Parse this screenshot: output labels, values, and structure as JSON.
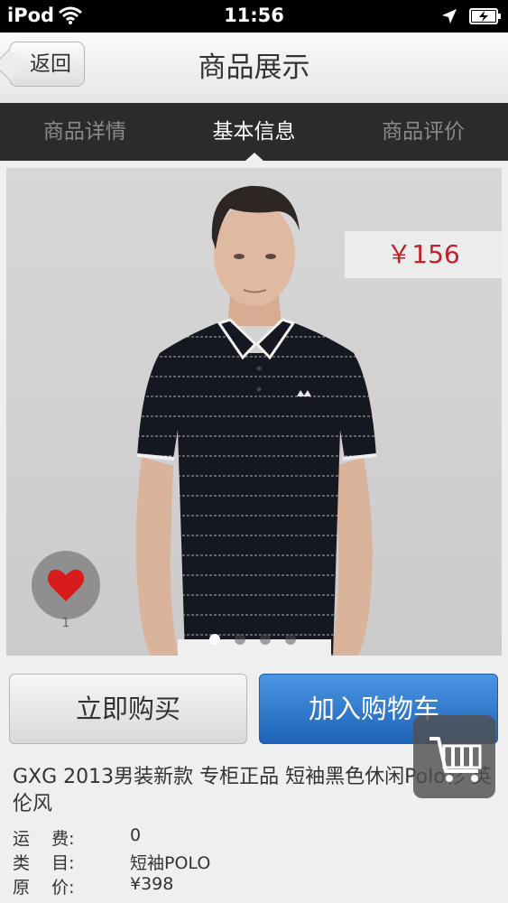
{
  "status_bar": {
    "carrier": "iPod",
    "time": "11:56"
  },
  "navbar": {
    "back_label": "返回",
    "title": "商品展示"
  },
  "tabs": [
    {
      "label": "商品详情"
    },
    {
      "label": "基本信息"
    },
    {
      "label": "商品评价"
    }
  ],
  "product": {
    "price": "￥156",
    "likes": "1",
    "image_count": 4,
    "current_image": 1,
    "title": "GXG 2013男装新款 专柜正品 短袖黑色休闲Polo衫 英伦风",
    "info": [
      {
        "key": "运    费:",
        "value": "0"
      },
      {
        "key": "类    目:",
        "value": "短袖POLO"
      },
      {
        "key": "原    价:",
        "value": "¥398"
      }
    ]
  },
  "actions": {
    "buy_now": "立即购买",
    "add_to_cart": "加入购物车"
  },
  "icons": {
    "wifi": "wifi-icon",
    "location": "location-arrow-icon",
    "battery": "battery-charging-icon",
    "like": "heart-icon",
    "cart": "shopping-cart-icon"
  },
  "colors": {
    "price": "#c21f2a",
    "cart_button": "#2a6fc4",
    "tab_bar": "#2b2b2b",
    "heart": "#d81c1c"
  }
}
